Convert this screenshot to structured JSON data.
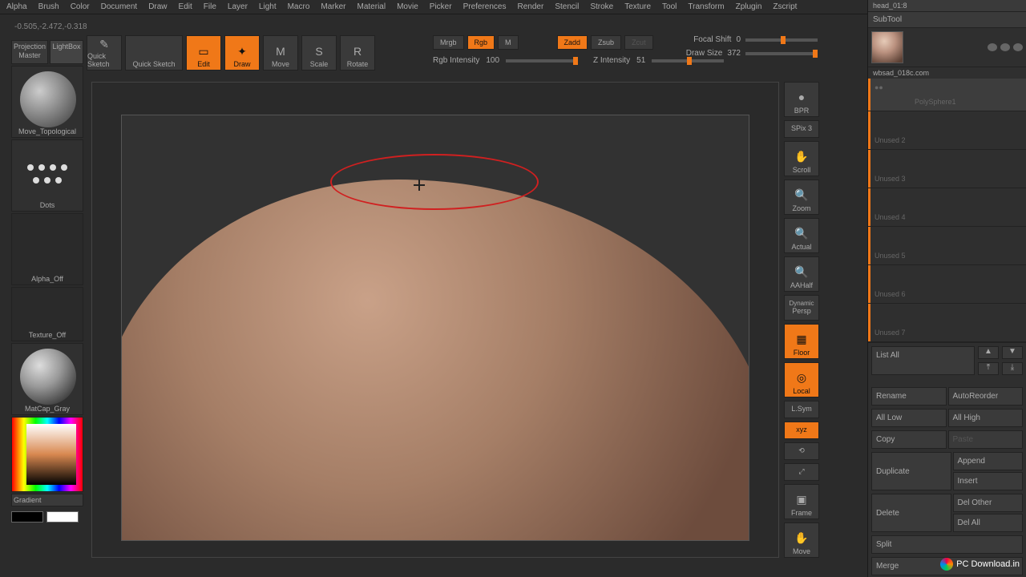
{
  "menu": [
    "Alpha",
    "Brush",
    "Color",
    "Document",
    "Draw",
    "Edit",
    "File",
    "Layer",
    "Light",
    "Macro",
    "Marker",
    "Material",
    "Movie",
    "Picker",
    "Preferences",
    "Render",
    "Stencil",
    "Stroke",
    "Texture",
    "Tool",
    "Transform",
    "Zplugin",
    "Zscript"
  ],
  "coord": "-0.505,-2.472,-0.318",
  "left": {
    "projection": "Projection Master",
    "lightbox": "LightBox",
    "brush": "Move_Topological",
    "stroke": "Dots",
    "alpha": "Alpha_Off",
    "texture": "Texture_Off",
    "material": "MatCap_Gray",
    "gradient": "Gradient"
  },
  "transform": {
    "quicksketch": "Quick Sketch",
    "edit": "Edit",
    "draw": "Draw",
    "move": "Move",
    "scale": "Scale",
    "rotate": "Rotate"
  },
  "paint": {
    "mrgb": "Mrgb",
    "rgb": "Rgb",
    "m": "M",
    "zadd": "Zadd",
    "zsub": "Zsub",
    "zcut": "Zcut",
    "rgb_intensity_lbl": "Rgb Intensity",
    "rgb_intensity_val": "100",
    "z_intensity_lbl": "Z Intensity",
    "z_intensity_val": "51"
  },
  "brush_sliders": {
    "focal_lbl": "Focal Shift",
    "focal_val": "0",
    "draw_lbl": "Draw Size",
    "draw_val": "372"
  },
  "nav": {
    "bpr": "BPR",
    "spix": "SPix 3",
    "scroll": "Scroll",
    "zoom": "Zoom",
    "actual": "Actual",
    "aahalf": "AAHalf",
    "persp": "Persp",
    "dynamic": "Dynamic",
    "floor": "Floor",
    "local": "Local",
    "lsym": "L.Sym",
    "xyz": "xyz",
    "frame": "Frame",
    "move": "Move"
  },
  "right": {
    "head_cur": "head_01:8",
    "subtool": "SubTool",
    "st1": "wbsad_018c.com",
    "st2": "PolySphere1",
    "unused": [
      "Unused 2",
      "Unused 3",
      "Unused 4",
      "Unused 5",
      "Unused 6",
      "Unused 7"
    ],
    "list_all": "List All",
    "rename": "Rename",
    "autoreorder": "AutoReorder",
    "alllow": "All Low",
    "allhigh": "All High",
    "copy": "Copy",
    "paste": "Paste",
    "duplicate": "Duplicate",
    "append": "Append",
    "insert": "Insert",
    "delete": "Delete",
    "delother": "Del Other",
    "delall": "Del All",
    "split": "Split",
    "merge": "Merge"
  },
  "pc": "PC Download.in"
}
